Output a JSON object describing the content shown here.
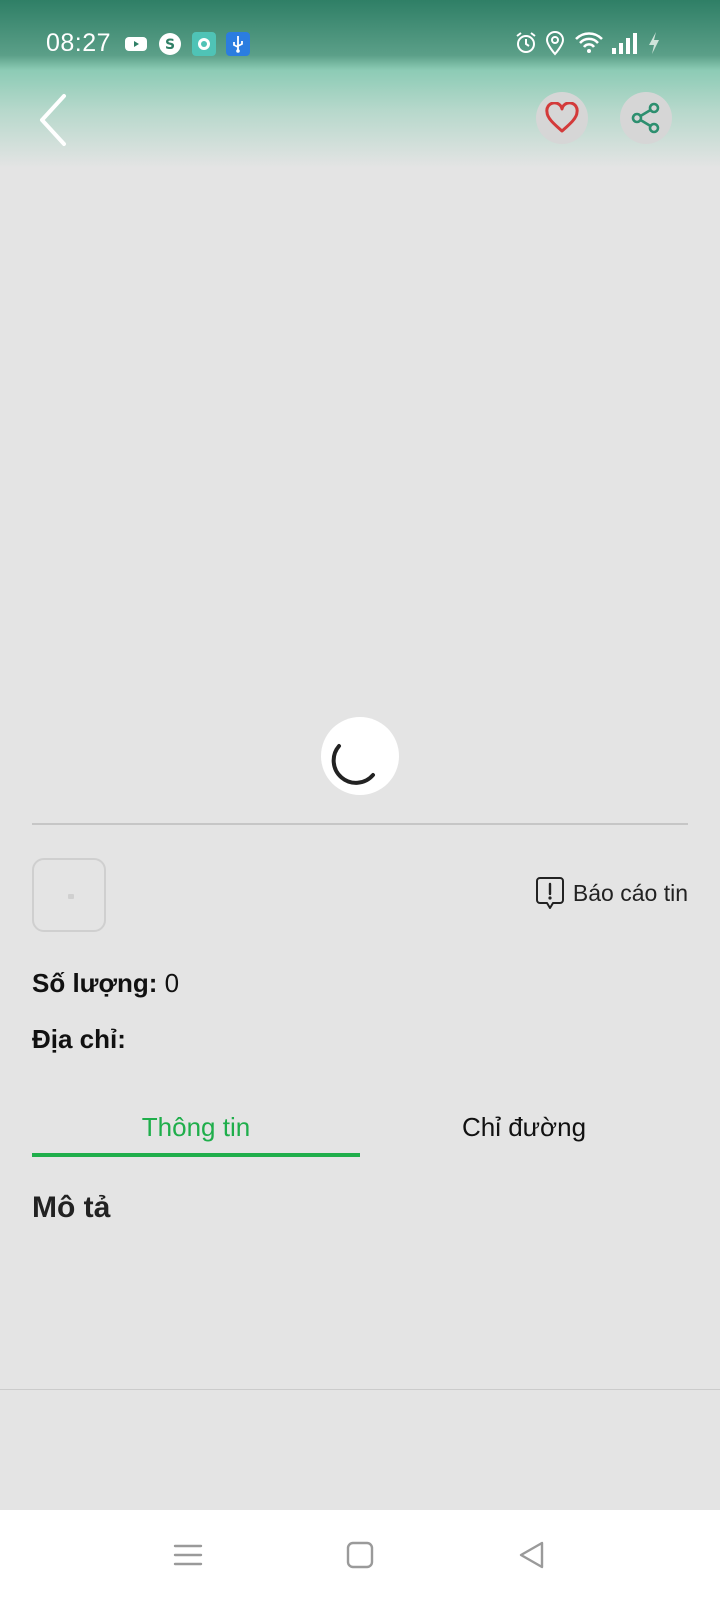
{
  "status_bar": {
    "time": "08:27",
    "app_icons": [
      "youtube-icon",
      "skype-icon",
      "app-icon",
      "usb-icon"
    ],
    "system_icons": [
      "alarm-icon",
      "location-icon",
      "wifi-icon",
      "signal-icon",
      "charging-icon"
    ]
  },
  "header": {
    "back_icon": "chevron-left-icon",
    "favorite_icon": "heart-icon",
    "share_icon": "share-icon"
  },
  "detail": {
    "report_label": "Báo cáo tin",
    "quantity_label": "Số lượng:",
    "quantity_value": "0",
    "address_label": "Địa chỉ:",
    "address_value": ""
  },
  "tabs": [
    {
      "label": "Thông tin",
      "active": true
    },
    {
      "label": "Chỉ đường",
      "active": false
    }
  ],
  "description": {
    "title": "Mô tả"
  },
  "colors": {
    "accent": "#1fae4b",
    "header_top": "#2f7f66",
    "favorite": "#d33a3a",
    "share": "#2d8f6f"
  },
  "nav_bar": [
    "menu-icon",
    "home-icon",
    "back-icon"
  ]
}
